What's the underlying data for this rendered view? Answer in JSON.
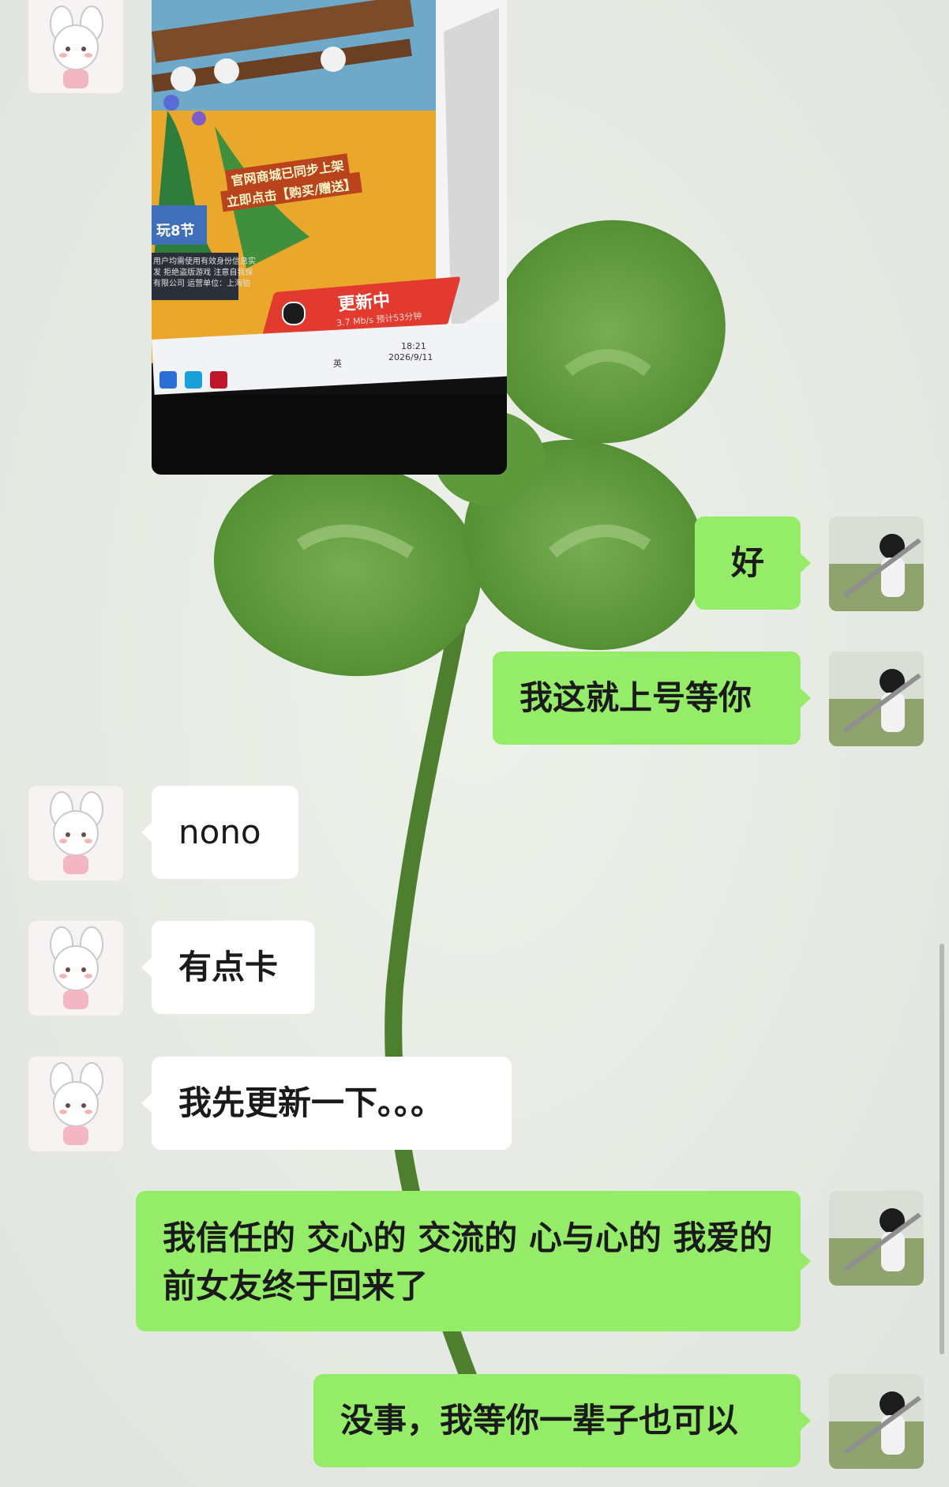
{
  "chat": {
    "photo_message": {
      "banner_line1": "官网商城已同步上架",
      "banner_line2": "立即点击【购买/赠送】",
      "update_label": "更新中",
      "update_detail": "3.7 Mb/s  预计53分钟",
      "promo_label": "玩8节",
      "notice_line1": "用户均需使用有效身份信息实",
      "notice_line2": "发 拒绝盗版游戏 注意自我保",
      "notice_line3": "有限公司 运营单位：上海铂",
      "tray_ime": "英",
      "tray_time": "18:21",
      "tray_date": "2026/9/11"
    },
    "messages": [
      {
        "sender": "self",
        "text": "好"
      },
      {
        "sender": "self",
        "text": "我这就上号等你"
      },
      {
        "sender": "peer",
        "text": "nono"
      },
      {
        "sender": "peer",
        "text": "有点卡"
      },
      {
        "sender": "peer",
        "text": "我先更新一下。。。"
      },
      {
        "sender": "self",
        "text": "我信任的 交心的 交流的 心与心的 我爱的前女友终于回来了"
      },
      {
        "sender": "self",
        "text": "没事，我等你一辈子也可以"
      }
    ]
  },
  "colors": {
    "self_bubble": "#95ec69",
    "peer_bubble": "#ffffff",
    "background": "#e9ebe6",
    "clover": "#5f9a3c"
  },
  "icons": {
    "peer_avatar": "cartoon-bunny-girl-avatar",
    "self_avatar": "girl-with-sword-photo-avatar"
  }
}
